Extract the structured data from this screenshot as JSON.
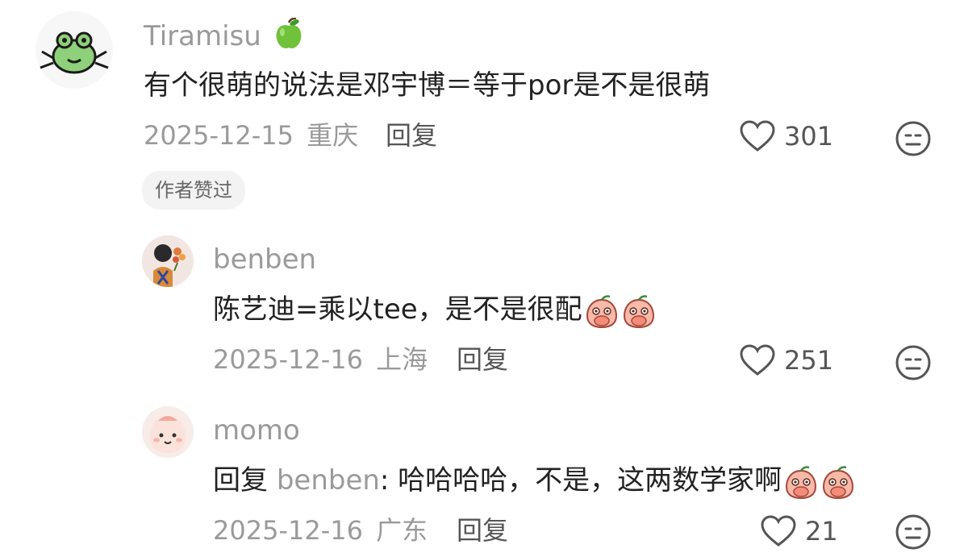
{
  "comments": [
    {
      "username": "Tiramisu",
      "username_emoji": "green-apple",
      "text": "有个很萌的说法是邓宇博＝等于por是不是很萌",
      "date": "2025-12-15",
      "location": "重庆",
      "reply_label": "回复",
      "likes": "301",
      "badge": "作者赞过"
    },
    {
      "username": "benben",
      "text": "陈艺迪=乘以tee，是不是很配",
      "emojis": [
        "peach-cover-mouth",
        "peach-cover-mouth"
      ],
      "date": "2025-12-16",
      "location": "上海",
      "reply_label": "回复",
      "likes": "251"
    },
    {
      "username": "momo",
      "reply_prefix": "回复",
      "reply_target": "benben",
      "text": ": 哈哈哈哈，不是，这两数学家啊",
      "emojis": [
        "peach-cover-mouth",
        "peach-cover-mouth"
      ],
      "date": "2025-12-16",
      "location": "广东",
      "reply_label": "回复",
      "likes": "21"
    }
  ],
  "colors": {
    "meta_gray": "#9a9a9a",
    "text_dark": "#222222",
    "badge_bg": "#f3f3f3"
  }
}
